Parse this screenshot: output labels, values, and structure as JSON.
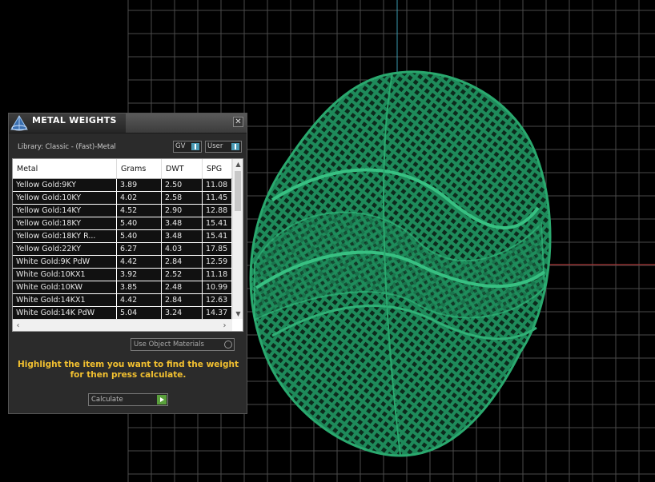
{
  "panel": {
    "title": "METAL WEIGHTS",
    "close_label": "✕",
    "library_label": "Library: Classic - (Fast)-Metal",
    "toggle_gv": "GV",
    "toggle_user": "User",
    "columns": [
      "Metal",
      "Grams",
      "DWT",
      "SPG"
    ],
    "rows": [
      [
        "Yellow Gold:9KY",
        "3.89",
        "2.50",
        "11.08"
      ],
      [
        "Yellow Gold:10KY",
        "4.02",
        "2.58",
        "11.45"
      ],
      [
        "Yellow Gold:14KY",
        "4.52",
        "2.90",
        "12.88"
      ],
      [
        "Yellow Gold:18KY",
        "5.40",
        "3.48",
        "15.41"
      ],
      [
        "Yellow Gold:18KY R...",
        "5.40",
        "3.48",
        "15.41"
      ],
      [
        "Yellow Gold:22KY",
        "6.27",
        "4.03",
        "17.85"
      ],
      [
        "White Gold:9K PdW",
        "4.42",
        "2.84",
        "12.59"
      ],
      [
        "White Gold:10KX1",
        "3.92",
        "2.52",
        "11.18"
      ],
      [
        "White Gold:10KW",
        "3.85",
        "2.48",
        "10.99"
      ],
      [
        "White Gold:14KX1",
        "4.42",
        "2.84",
        "12.63"
      ],
      [
        "White Gold:14K PdW",
        "5.04",
        "3.24",
        "14.37"
      ]
    ],
    "use_materials_label": "Use Object Materials",
    "hint": "Highlight the item you want to find the weight for then press calculate.",
    "calculate_label": "Calculate"
  },
  "colors": {
    "mesh": "#1e8a5a",
    "grid": "#4a4a4a",
    "accent_hint": "#f2c030",
    "axis_red": "#c03030",
    "axis_teal": "#3a9ab0"
  },
  "icons": [
    "logo-icon",
    "close-icon",
    "scroll-up-icon",
    "scroll-down-icon",
    "scroll-left-icon",
    "scroll-right-icon",
    "play-icon",
    "radio-icon"
  ]
}
